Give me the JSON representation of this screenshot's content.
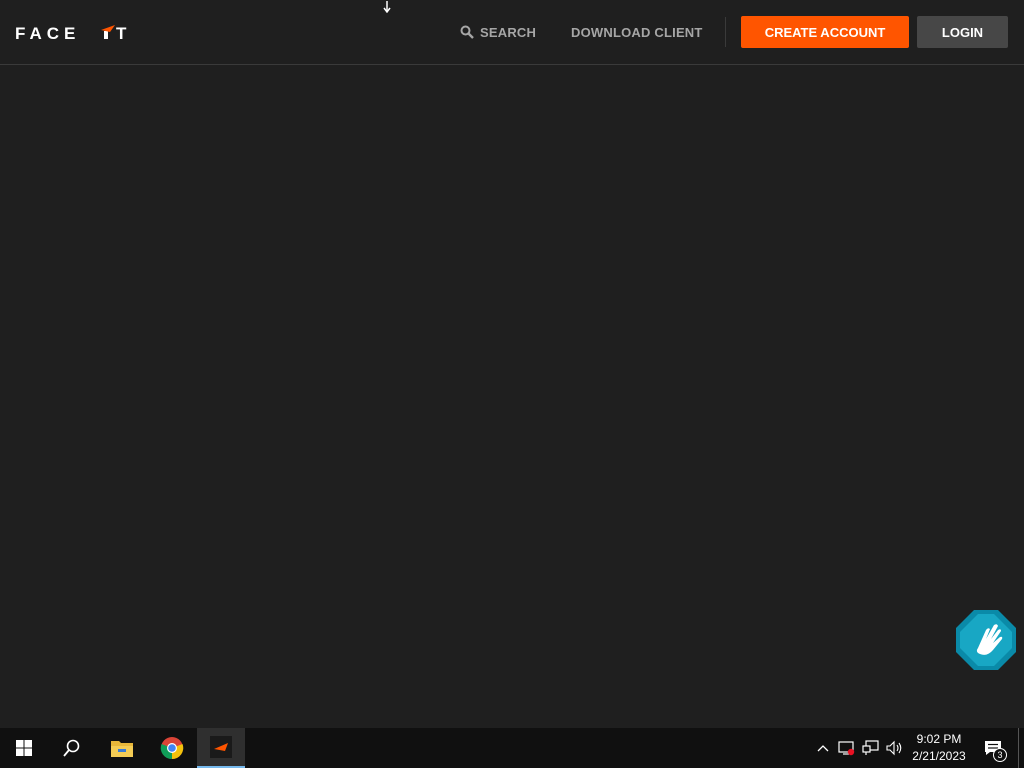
{
  "app": {
    "logo_text": "FACEIT",
    "brand_color": "#ff5500"
  },
  "header": {
    "search_label": "SEARCH",
    "download_label": "DOWNLOAD CLIENT",
    "create_account_label": "CREATE ACCOUNT",
    "login_label": "LOGIN"
  },
  "taskbar": {
    "time": "9:02 PM",
    "date": "2/21/2023",
    "notification_count": "3",
    "pinned": [
      "start-icon",
      "search-icon",
      "file-explorer-icon",
      "chrome-icon",
      "faceit-app-icon"
    ],
    "tray": [
      "chevron-up-icon",
      "security-icon",
      "network-icon",
      "volume-icon",
      "notification-icon"
    ]
  },
  "widgets": {
    "help_icon": "wave-hand-icon"
  }
}
